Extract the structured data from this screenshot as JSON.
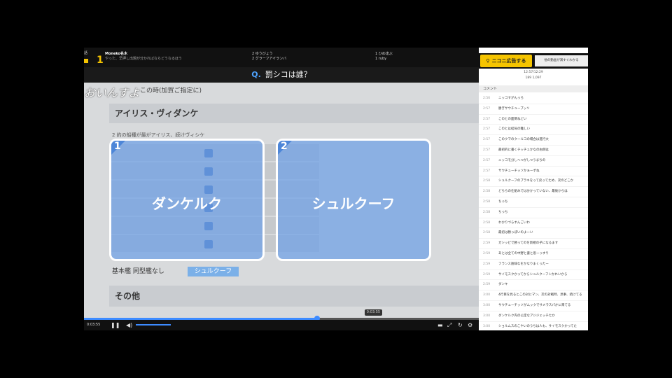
{
  "ranking": {
    "left_badge": "話",
    "first_rank": "1",
    "first_name": "Moneko名木",
    "first_sub": "やった、早押し出題が分かればならどうなるほう",
    "second_rank": "2",
    "second_name": "ゆうびょう",
    "third_rank": "2",
    "third_name": "グラーフアイランバ",
    "fourth_rank": "1",
    "fourth_name": "ひめ達ぶ",
    "fifth_rank": "1",
    "fifth_name": "ruby"
  },
  "question": {
    "prefix": "Q.",
    "text": "罰シコは誰？"
  },
  "video": {
    "scribble": "おいんすよ",
    "top_label": "この時(加賀ご指定に)",
    "section_title": "アイリス・ヴィダンケ",
    "category_label": "2 約の船種が最がアイリス、続けヴィシケ",
    "bottom_row_label": "基本艦  同型艦なし",
    "bottom_row_value": "シュルクーフ",
    "other_section": "その他",
    "seek_time": "0:03:55"
  },
  "answers": [
    {
      "num": "1",
      "label": "ダンケルク"
    },
    {
      "num": "2",
      "label": "シュルクーフ"
    }
  ],
  "progress": {
    "seek_percent": 59,
    "volume_percent": 55
  },
  "controls": {
    "time": "0:03:55",
    "play_icon": "pause-icon",
    "volume_icon": "speaker-icon"
  },
  "panel": {
    "share_label": "ニコニ広告する",
    "side_label": "他の動画が演すぐわかる",
    "stats_line1": "12:57/12:29",
    "stats_line2": "189  1,097",
    "comment_header": "コメント",
    "comments": [
      {
        "time": "2:56",
        "text": "ニッコすがんっろ"
      },
      {
        "time": "2:57",
        "text": "勝ぎサウチュープッソ"
      },
      {
        "time": "2:57",
        "text": "このとの面倒ねどい"
      },
      {
        "time": "2:57",
        "text": "このとは結局の難しい"
      },
      {
        "time": "2:57",
        "text": "このクマのクールコの場合は進行大"
      },
      {
        "time": "2:57",
        "text": "最初的に書くチッチュかなの右側は"
      },
      {
        "time": "2:57",
        "text": "ニッコモ分しへつがしつうまちの"
      },
      {
        "time": "2:57",
        "text": "サウチューチッソかぁーずね"
      },
      {
        "time": "2:58",
        "text": "シュルクーフのプラキをって戻ってため、次のどこか"
      },
      {
        "time": "2:58",
        "text": "どちらの仕組みでは分かっていない、最後からは"
      },
      {
        "time": "2:58",
        "text": "ちっち"
      },
      {
        "time": "2:58",
        "text": "ちっち"
      },
      {
        "time": "2:58",
        "text": "わかりづらすんごいわ"
      },
      {
        "time": "2:58",
        "text": "最初は勝っぽいのよーい"
      },
      {
        "time": "2:59",
        "text": "ガシッピで勝ってのを新規の子になるます"
      },
      {
        "time": "2:59",
        "text": "あとは全ての中野と書と思ーっすり"
      },
      {
        "time": "2:59",
        "text": "フランス語辞なをかなりまくったー"
      },
      {
        "time": "2:59",
        "text": "サイモスクかってからシュルクーフシかれいから"
      },
      {
        "time": "2:59",
        "text": "ダンキ"
      },
      {
        "time": "3:00",
        "text": "4行目を見るとこの対にマン、次の対戦時、見事、続けてる"
      },
      {
        "time": "3:00",
        "text": "サウチューチッソがムックでサメラスパかに来てる"
      },
      {
        "time": "3:00",
        "text": "ダンケルク内の公定なアジジェッチたか"
      },
      {
        "time": "3:00",
        "text": "ショルムスのこやいのうちは人も、サイモスクかってた"
      }
    ]
  }
}
